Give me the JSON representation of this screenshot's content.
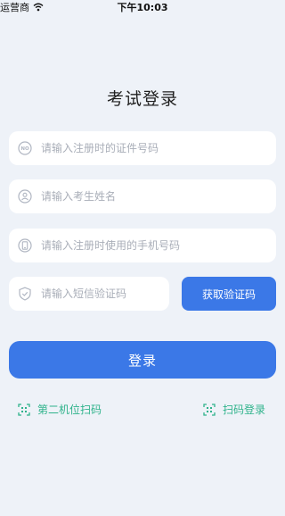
{
  "status_bar": {
    "carrier": "运营商",
    "time": "下午10:03"
  },
  "title": "考试登录",
  "fields": {
    "id_number": {
      "placeholder": "请输入注册时的证件号码",
      "value": ""
    },
    "name": {
      "placeholder": "请输入考生姓名",
      "value": ""
    },
    "phone": {
      "placeholder": "请输入注册时使用的手机号码",
      "value": ""
    },
    "sms_code": {
      "placeholder": "请输入短信验证码",
      "value": ""
    }
  },
  "buttons": {
    "get_code": "获取验证码",
    "login": "登录"
  },
  "links": {
    "second_position_scan": "第二机位扫码",
    "scan_login": "扫码登录"
  },
  "colors": {
    "primary": "#3b78e7",
    "accent_green": "#2fb38b",
    "background": "#eef2f8",
    "icon_gray": "#b0b6c2"
  },
  "icons": {
    "id": "id-card-icon",
    "name": "user-icon",
    "phone": "phone-icon",
    "code": "shield-check-icon",
    "scan": "scan-qr-icon"
  }
}
